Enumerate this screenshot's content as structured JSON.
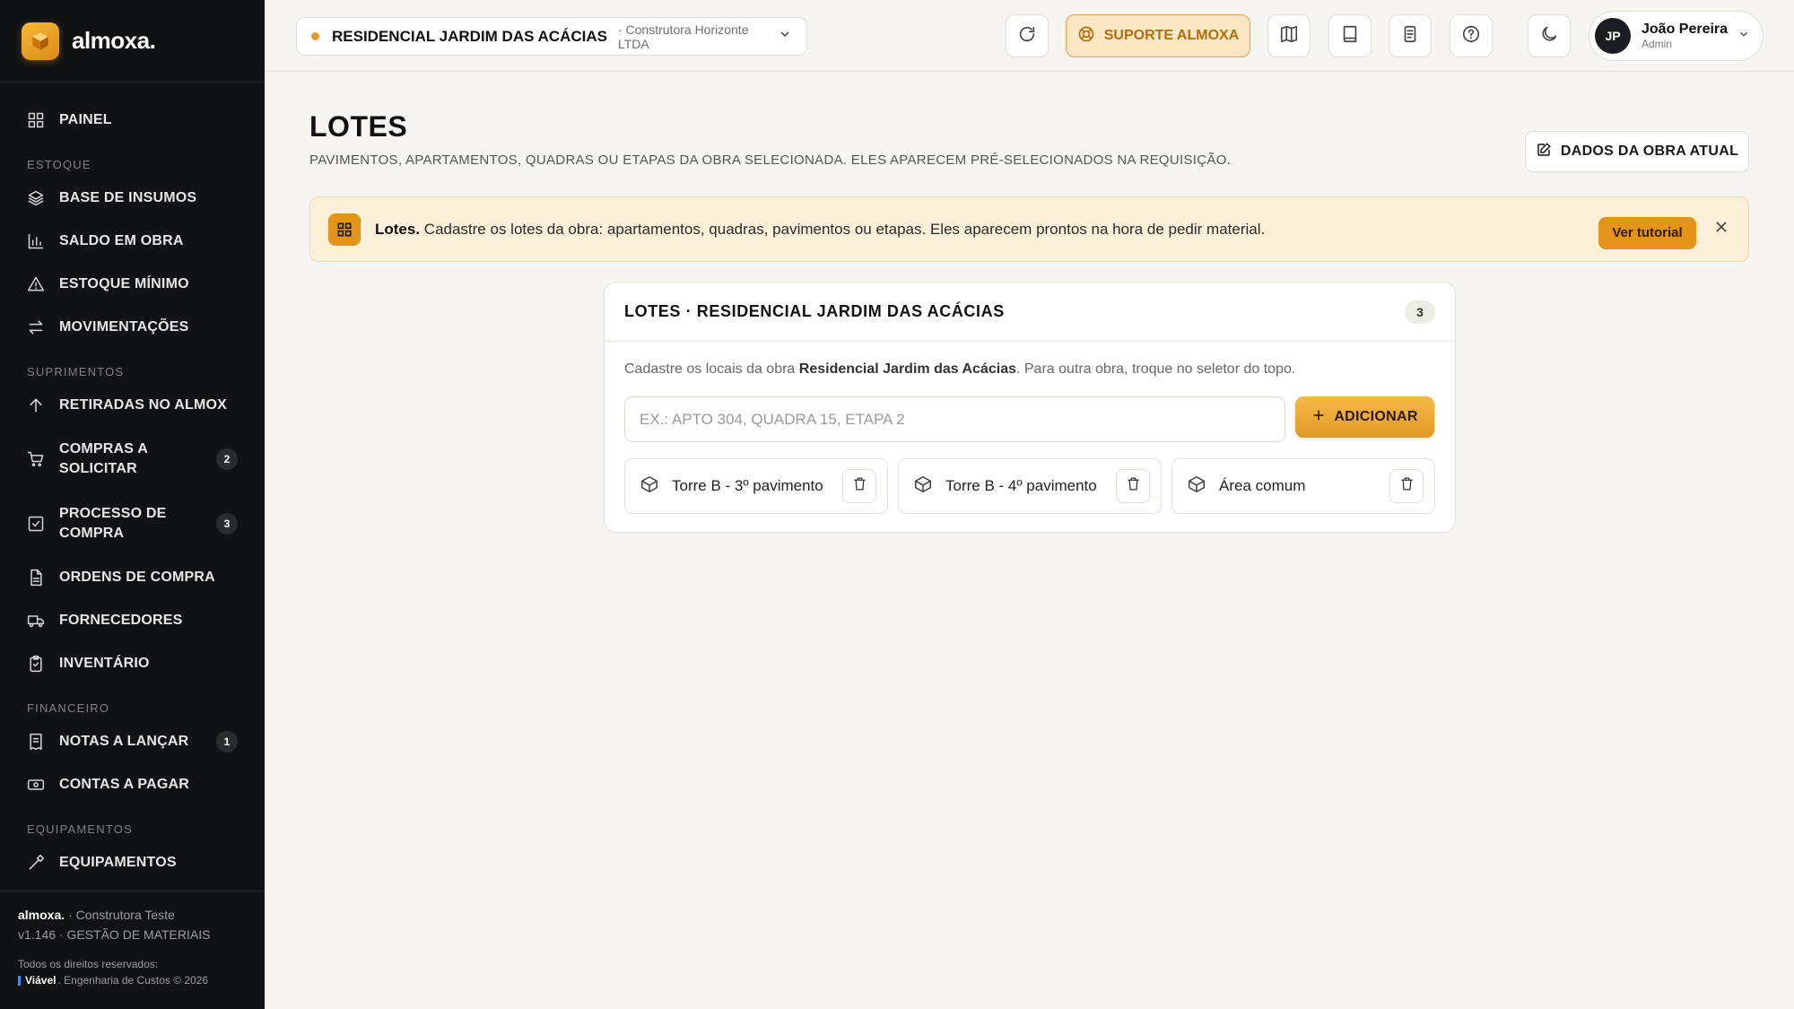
{
  "brand": {
    "name": "almoxa."
  },
  "sidebar": {
    "items": [
      {
        "label": "PAINEL",
        "icon": "dashboard-icon"
      },
      {
        "section": "ESTOQUE"
      },
      {
        "label": "BASE DE INSUMOS",
        "icon": "layers-icon"
      },
      {
        "label": "SALDO EM OBRA",
        "icon": "bar-chart-icon"
      },
      {
        "label": "ESTOQUE MÍNIMO",
        "icon": "warning-icon"
      },
      {
        "label": "MOVIMENTAÇÕES",
        "icon": "arrows-swap-icon"
      },
      {
        "section": "SUPRIMENTOS"
      },
      {
        "label": "RETIRADAS NO ALMOX",
        "icon": "arrow-up-icon"
      },
      {
        "label": "COMPRAS A SOLICITAR",
        "icon": "cart-icon",
        "count": "2"
      },
      {
        "label": "PROCESSO DE COMPRA",
        "icon": "check-square-icon",
        "count": "3"
      },
      {
        "label": "ORDENS DE COMPRA",
        "icon": "document-icon"
      },
      {
        "label": "FORNECEDORES",
        "icon": "truck-icon"
      },
      {
        "label": "INVENTÁRIO",
        "icon": "clipboard-icon"
      },
      {
        "section": "FINANCEIRO"
      },
      {
        "label": "NOTAS A LANÇAR",
        "icon": "receipt-icon",
        "count": "1"
      },
      {
        "label": "CONTAS A PAGAR",
        "icon": "cash-icon"
      },
      {
        "section": "EQUIPAMENTOS"
      },
      {
        "label": "EQUIPAMENTOS",
        "icon": "tool-icon"
      }
    ],
    "footer": {
      "brand": "almoxa.",
      "company": "· Construtora Teste",
      "version": "v1.146 · GESTÃO DE MATERIAIS",
      "rights": "Todos os direitos reservados:",
      "credit_brand": "Viável",
      "credit_text": ". Engenharia de Custos © 2026"
    }
  },
  "topbar": {
    "project_name": "RESIDENCIAL JARDIM DAS ACÁCIAS",
    "project_company": "· Construtora Horizonte LTDA",
    "support_label": "SUPORTE ALMOXA",
    "user": {
      "initials": "JP",
      "name": "João Pereira",
      "role": "Admin"
    }
  },
  "page": {
    "title": "LOTES",
    "subtitle": "PAVIMENTOS, APARTAMENTOS, QUADRAS OU ETAPAS DA OBRA SELECIONADA. ELES APARECEM PRÉ-SELECIONADOS NA REQUISIÇÃO.",
    "obra_button": "DADOS DA OBRA ATUAL"
  },
  "banner": {
    "title": "Lotes.",
    "text": " Cadastre os lotes da obra: apartamentos, quadras, pavimentos ou etapas. Eles aparecem prontos na hora de pedir material.",
    "tutorial_label": "Ver tutorial"
  },
  "card": {
    "title": "LOTES · RESIDENCIAL JARDIM DAS ACÁCIAS",
    "count": "3",
    "desc_pre": "Cadastre os locais da obra ",
    "desc_bold": "Residencial Jardim das Acácias",
    "desc_post": ". Para outra obra, troque no seletor do topo.",
    "input_placeholder": "EX.: APTO 304, QUADRA 15, ETAPA 2",
    "input_value": "",
    "add_label": "ADICIONAR",
    "lots": [
      {
        "name": "Torre B - 3º pavimento"
      },
      {
        "name": "Torre B - 4º pavimento"
      },
      {
        "name": "Área comum"
      }
    ]
  },
  "colors": {
    "accent": "#E39419",
    "sidebar_bg": "#111214",
    "page_bg": "#F7F5F1"
  }
}
